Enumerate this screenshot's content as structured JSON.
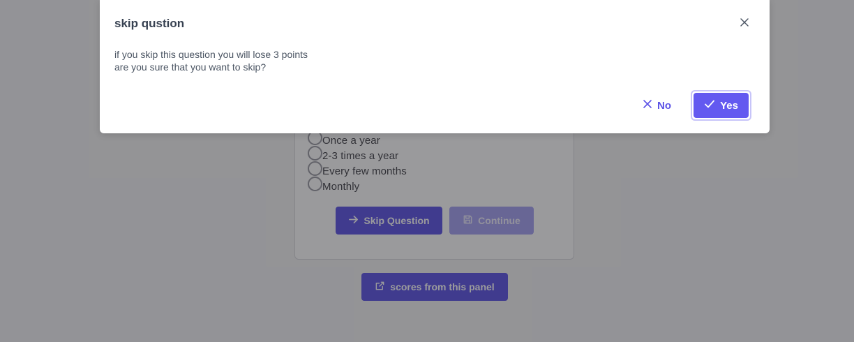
{
  "question": {
    "options": [
      "Once a year",
      "2-3 times a year",
      "Every few months",
      "Monthly"
    ],
    "skip_label": "Skip Question",
    "continue_label": "Continue",
    "scores_label": "scores from this panel"
  },
  "dialog": {
    "title": "skip qustion",
    "message_line1": "if you skip this question you will lose 3 points",
    "message_line2": "are you sure that you want to skip?",
    "no_label": "No",
    "yes_label": "Yes"
  },
  "colors": {
    "primary": "#5b52e6",
    "primary_light": "#6359f0",
    "primary_disabled": "#a5a0f2"
  }
}
